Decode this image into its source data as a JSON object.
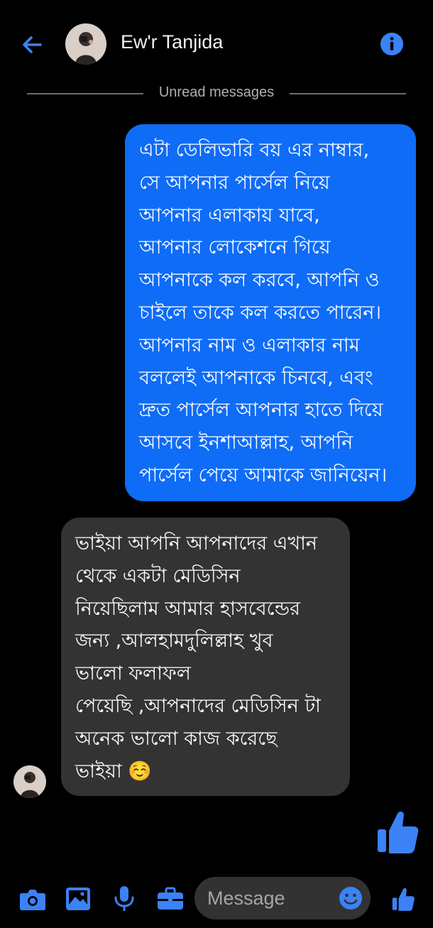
{
  "header": {
    "contact_name": "Ew'r Tanjida",
    "back_icon": "arrow-left-icon",
    "info_icon": "info-icon"
  },
  "divider": {
    "label": "Unread messages"
  },
  "messages": [
    {
      "direction": "outgoing",
      "text": "এটা ডেলিভারি বয় এর নাম্বার,\nসে আপনার পার্সেল নিয়ে\nআপনার এলাকায় যাবে,\nআপনার লোকেশনে গিয়ে\nআপনাকে কল করবে, আপনি ও\nচাইলে তাকে কল করতে পারেন।\nআপনার নাম ও এলাকার নাম\nবললেই আপনাকে চিনবে, এবং\nদ্রুত পার্সেল আপনার হাতে দিয়ে\nআসবে ইনশাআল্লাহ, আপনি\nপার্সেল পেয়ে আমাকে জানিয়েন।"
    },
    {
      "direction": "incoming",
      "text": "ভাইয়া আপনি আপনাদের এখান\nথেকে একটা মেডিসিন\nনিয়েছিলাম আমার হাসবেন্ডের\nজন্য ,আলহামদুলিল্লাহ খুব\nভালো ফলাফল\nপেয়েছি ,আপনাদের মেডিসিন টা\nঅনেক ভালো কাজ করেছে\nভাইয়া ☺️"
    }
  ],
  "sent_reaction": {
    "icon": "thumbs-up-icon"
  },
  "composer": {
    "placeholder": "Message",
    "value": "",
    "tools": [
      "camera-icon",
      "image-icon",
      "microphone-icon",
      "briefcase-icon"
    ],
    "emoji_icon": "smiley-icon",
    "send_icon": "thumbs-up-icon"
  },
  "colors": {
    "background": "#000000",
    "accent": "#0f6cf7",
    "icon_blue": "#3b82f6",
    "incoming_bubble": "#333333",
    "field_bg": "#323232"
  }
}
